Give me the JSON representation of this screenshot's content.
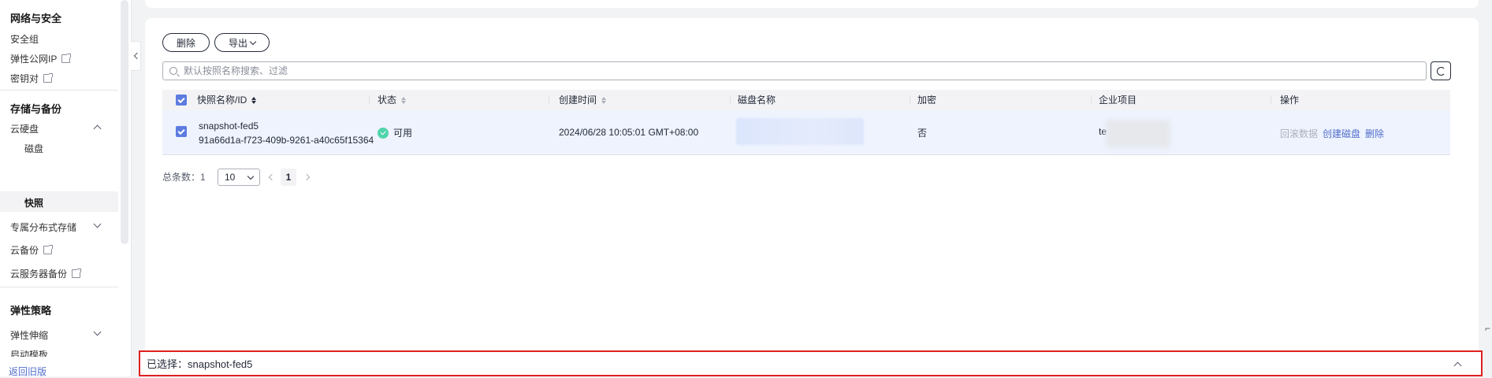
{
  "sidebar": {
    "groups": [
      {
        "title": "网络与安全"
      },
      {
        "title": "存储与备份"
      },
      {
        "title": "弹性策略"
      }
    ],
    "items": {
      "security_group": "安全组",
      "eip": "弹性公网IP",
      "keypair": "密钥对",
      "evs": "云硬盘",
      "disk": "磁盘",
      "snapshot": "快照",
      "dss": "专属分布式存储",
      "cbr": "云备份",
      "csbs": "云服务器备份",
      "as": "弹性伸缩",
      "truncated": "启动模板"
    },
    "old_version_link": "返回旧版"
  },
  "toolbar": {
    "delete_label": "删除",
    "export_label": "导出"
  },
  "search": {
    "placeholder": "默认按照名称搜索、过滤"
  },
  "table": {
    "headers": {
      "name": "快照名称/ID",
      "status": "状态",
      "created": "创建时间",
      "disk_name": "磁盘名称",
      "encrypted": "加密",
      "project": "企业项目",
      "actions": "操作"
    },
    "rows": [
      {
        "name": "snapshot-fed5",
        "id": "91a66d1a-f723-409b-9261-a40c65f15364",
        "status": "可用",
        "created": "2024/06/28 10:05:01 GMT+08:00",
        "encrypted": "否",
        "project": "te",
        "actions": {
          "rollback": "回滚数据",
          "create_disk": "创建磁盘",
          "delete": "删除"
        }
      }
    ]
  },
  "pagination": {
    "total_label": "总条数：",
    "total": "1",
    "page_size": "10",
    "current_page": "1"
  },
  "selection_bar": {
    "text": "已选择：snapshot-fed5"
  },
  "colors": {
    "accent": "#5e7ce0",
    "link": "#526ecc",
    "status_ok": "#50d4ab",
    "highlight_border": "#e02020",
    "row_selected": "#eef3fe"
  },
  "icons": {
    "sidebar_external": "external-link-icon",
    "search": "search-icon",
    "refresh": "refresh-icon",
    "status": "check-circle-icon"
  }
}
